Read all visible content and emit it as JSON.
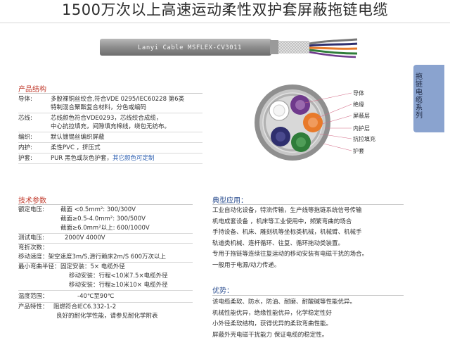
{
  "page_title": "1500万次以上高速运动柔性双护套屏蔽拖链电缆",
  "cable_print": "Lanyi Cable MSFLEX-CV3011",
  "side_tab": "拖链电缆系列",
  "structure": {
    "heading": "产品结构",
    "rows": [
      {
        "label": "导体:",
        "lines": [
          "多股裸铜丝绞合,符合VDE 0295/IEC60228 第6类",
          "特制混合聚酯复合材料，分色或编码"
        ]
      },
      {
        "label": "芯线:",
        "lines": [
          "芯线颜色符合VDE0293，芯线绞合成缆，",
          "中心抗拉填充，间隙填充棉线，绕包无纺布。"
        ]
      },
      {
        "label": "编织:",
        "lines": [
          "默认镀锡丝编织屏蔽"
        ]
      },
      {
        "label": "内护:",
        "lines": [
          "柔性PVC ，挤压式"
        ]
      },
      {
        "label": "护套:",
        "lines": [
          "PUR 黑色或灰色护套，"
        ],
        "extra": "其它颜色可定制"
      }
    ]
  },
  "cross_section": {
    "labels": [
      "导体",
      "绝缘",
      "屏蔽层",
      "内护层",
      "抗拉填充",
      "护套"
    ],
    "colors": {
      "outer": "#9a9a9a",
      "inner": "#c7c7c7",
      "core_a": "#ffffff",
      "core_b": "#6f3a8c",
      "core_c": "#e87a2a",
      "core_d": "#2f2f6e",
      "core_e": "#2f7d3a"
    }
  },
  "tech": {
    "heading": "技术参数",
    "rated_label": "额定电压:",
    "rated": [
      "截面  <0.5mm²:   300/300V",
      "截面≥0.5-4.0mm²: 300/500V",
      "截面≥6.0mm²以上: 600/1000V"
    ],
    "test_label": "测试电压:",
    "test_value": "2000V 4000V",
    "bend_count": "弯折次数：",
    "speed": "移动速度：架空速度3m/S,滑行赖床2m/S 600万次以上",
    "radius_label": "最小弯曲半径：",
    "radius": [
      "固定安装：5× 电缆外径",
      "移动安装：行程<10米7.5×电缆外径",
      "移动安装：行程≥10米10× 电缆外径"
    ],
    "temp_label": "温度范围：",
    "temp_value": "-40℃至90℃",
    "property_label": "产品特性：",
    "property": [
      "阻燃符合IEC6.332-1-2",
      "良好的耐化学性能，请参见耐化学附表"
    ]
  },
  "application": {
    "heading": "典型应用：",
    "lines": [
      "工业自动化设备，特流传输，生产线等拖链系统信号传输",
      "机电成套设备 ，机床等工业使用中，频繁弯曲的场合",
      "手持设备、机床、雕刻机等坐标类机械，机械臂、机械手",
      "轨道类机械、连杆循环、往复、循环拖动类装置。",
      "专用于拖链等连续往复运动的移动安装有电磁干扰的场合。",
      "一般用于电源/动力传递。"
    ]
  },
  "advantages": {
    "heading": "优势：",
    "lines": [
      "该电缆柔软、防水，防油、耐磨、耐酸碱等性能优异。",
      "机械性能优异，绝缘性能优异，化学稳定性好",
      "小外径柔软结构，获得优异的柔软弯曲性能。",
      "屏蔽外壳电磁干扰能力 保证电缆的稳定性。"
    ]
  }
}
